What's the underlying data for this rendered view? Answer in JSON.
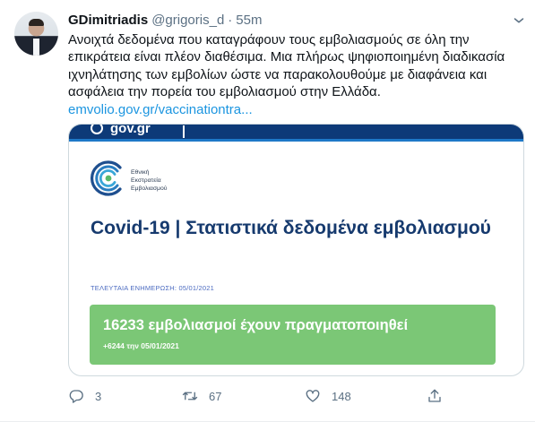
{
  "tweet": {
    "author_name": "GDimitriadis",
    "handle": "@grigoris_d",
    "separator": "·",
    "time": "55m",
    "text_lines": [
      "Ανοιχτά δεδομένα που καταγράφουν τους εμβολιασμούς σε όλη την",
      "επικράτεια είναι πλέον διαθέσιμα. Μια πλήρως ψηφιοποιημένη διαδικασία",
      "ιχνηλάτησης των εμβολίων ώστε να παρακολουθούμε με διαφάνεια και",
      "ασφάλεια την πορεία του εμβολιασμού στην Ελλάδα."
    ],
    "link": "emvolio.gov.gr/vaccinationtra..."
  },
  "card": {
    "band_logo": "gov.gr",
    "logo_text": [
      "Εθνική",
      "Εκστρατεία",
      "Εμβολιασμού"
    ],
    "title": "Covid-19 | Στατιστικά δεδομένα εμβολιασμού",
    "update_label": "ΤΕΛΕΥΤΑΙΑ ΕΝΗΜΕΡΩΣΗ: 05/01/2021",
    "stat_main": "16233 εμβολιασμοί έχουν πραγματοποιηθεί",
    "stat_sub": "+6244 την 05/01/2021"
  },
  "actions": {
    "reply_count": "3",
    "retweet_count": "67",
    "like_count": "148"
  },
  "colors": {
    "link": "#1b95e0",
    "muted": "#5b7083",
    "card_title": "#163a6e",
    "stat_green": "#7bc776",
    "gov_band": "#0d3a78"
  },
  "icons": [
    "more-icon",
    "reply-icon",
    "retweet-icon",
    "like-icon",
    "share-icon",
    "vaccination-campaign-logo"
  ]
}
